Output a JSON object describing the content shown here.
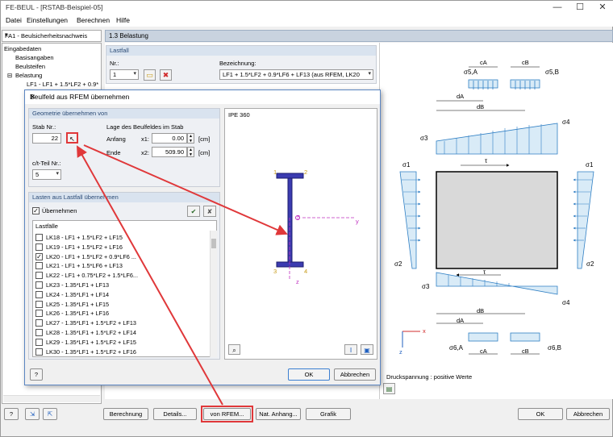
{
  "window": {
    "title": "FE-BEUL - [RSTAB-Beispiel-05]",
    "minimize": "—",
    "maximize": "☐",
    "close": "✕"
  },
  "menu": [
    "Datei",
    "Einstellungen",
    "Berechnen",
    "Hilfe"
  ],
  "left_panel": {
    "selector": "FA1 - Beulsicherheitsnachweis",
    "tree": [
      "Eingabedaten",
      "Basisangaben",
      "Beulsteifen",
      "Belastung",
      "LF1 - LF1 + 1.5*LF2 + 0.9*"
    ]
  },
  "section": {
    "header": "1.3 Belastung",
    "group_title": "Lastfall",
    "nr_label": "Nr.:",
    "nr_value": "1",
    "bez_label": "Bezeichnung:",
    "bez_value": "LF1 + 1.5*LF2 + 0.9*LF6 + LF13 (aus RFEM, LK20"
  },
  "diagram": {
    "labels": {
      "sigma5a": "σ5,A",
      "sigma5b": "σ5,B",
      "ca": "cA",
      "cb": "cB",
      "da": "dA",
      "db": "dB",
      "sigma3": "σ3",
      "sigma4": "σ4",
      "sigma1": "σ1",
      "sigma2": "σ2",
      "tau": "τ",
      "sigma6a": "σ6,A",
      "sigma6b": "σ6,B",
      "x": "x",
      "z": "z"
    },
    "note": "Druckspannung : positive Werte"
  },
  "bottom_buttons": [
    "Berechnung",
    "Details...",
    "von RFEM...",
    "Nat. Anhang...",
    "Grafik",
    "OK",
    "Abbrechen"
  ],
  "dialog": {
    "title": "Beulfeld aus RFEM übernehmen",
    "geo_group": "Geometrie übernehmen von",
    "stab_label": "Stab Nr.:",
    "stab_value": "22",
    "lage_label": "Lage des Beulfeldes im Stab",
    "anfang_label": "Anfang",
    "anfang_sym": "x1:",
    "anfang_value": "0.00",
    "ende_label": "Ende",
    "ende_sym": "x2:",
    "ende_value": "509.90",
    "unit": "[cm]",
    "ct_label": "c/t-Teil Nr.:",
    "ct_value": "5",
    "section_name": "IPE 360",
    "loads_group": "Lasten aus Lastfall übernehmen",
    "uebernehmen": "Übernehmen",
    "lastfaelle_header": "Lastfälle",
    "lastfaelle": [
      {
        "label": "LK18 - LF1 + 1.5*LF2 + LF15",
        "checked": false
      },
      {
        "label": "LK19 - LF1 + 1.5*LF2 + LF16",
        "checked": false
      },
      {
        "label": "LK20 - LF1 + 1.5*LF2 + 0.9*LF6 ...",
        "checked": true
      },
      {
        "label": "LK21 - LF1 + 1.5*LF6 + LF13",
        "checked": false
      },
      {
        "label": "LK22 - LF1 + 0.75*LF2 + 1.5*LF6...",
        "checked": false
      },
      {
        "label": "LK23 - 1.35*LF1 + LF13",
        "checked": false
      },
      {
        "label": "LK24 - 1.35*LF1 + LF14",
        "checked": false
      },
      {
        "label": "LK25 - 1.35*LF1 + LF15",
        "checked": false
      },
      {
        "label": "LK26 - 1.35*LF1 + LF16",
        "checked": false
      },
      {
        "label": "LK27 - 1.35*LF1 + 1.5*LF2 + LF13",
        "checked": false
      },
      {
        "label": "LK28 - 1.35*LF1 + 1.5*LF2 + LF14",
        "checked": false
      },
      {
        "label": "LK29 - 1.35*LF1 + 1.5*LF2 + LF15",
        "checked": false
      },
      {
        "label": "LK30 - 1.35*LF1 + 1.5*LF2 + LF16",
        "checked": false
      }
    ],
    "ok": "OK",
    "cancel": "Abbrechen",
    "axis_y": "y",
    "axis_z": "z",
    "pt1": "1",
    "pt2": "2",
    "pt3": "3",
    "pt4": "4",
    "pt5": "5"
  },
  "colors": {
    "accent_red": "#e0383a",
    "hatch_blue": "#2f7fc4",
    "dialog_border": "#5b86c2"
  }
}
